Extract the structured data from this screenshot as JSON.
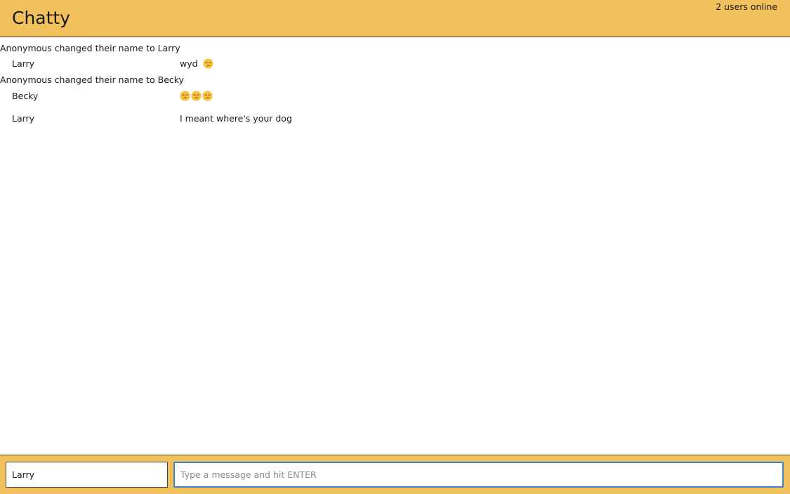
{
  "header": {
    "title": "Chatty",
    "users_online": "2 users online"
  },
  "messages": [
    {
      "type": "system",
      "text": "Anonymous changed their name to Larry"
    },
    {
      "type": "chat",
      "author": "Larry",
      "text": "wyd",
      "emojis": [
        "smirk-face-icon"
      ]
    },
    {
      "type": "system",
      "text": "Anonymous changed their name to Becky"
    },
    {
      "type": "chat",
      "author": "Becky",
      "text": "",
      "emojis": [
        "smirk-face-icon",
        "smirk-face-icon",
        "smirk-face-icon"
      ]
    },
    {
      "type": "chat",
      "author": "Larry",
      "text": "I meant where's your dog",
      "emojis": []
    }
  ],
  "footer": {
    "name_value": "Larry",
    "message_placeholder": "Type a message and hit ENTER",
    "message_value": ""
  },
  "colors": {
    "header_bg": "#f0c15c",
    "footer_bg": "#f0c15c",
    "focus_border": "#3b84c9"
  }
}
